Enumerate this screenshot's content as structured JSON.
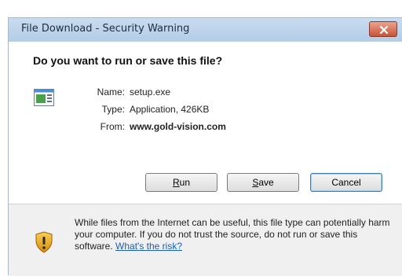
{
  "dialog": {
    "title": "File Download - Security Warning",
    "question": "Do you want to run or save this file?",
    "name_label": "Name:",
    "name_value": "setup.exe",
    "type_label": "Type:",
    "type_value": "Application, 426KB",
    "from_label": "From:",
    "from_value": "www.gold-vision.com",
    "buttons": {
      "run_mnemonic": "R",
      "run_rest": "un",
      "save_mnemonic": "S",
      "save_rest": "ave",
      "cancel": "Cancel"
    },
    "warning_text": "While files from the Internet can be useful, this file type can potentially harm your computer. If you do not trust the source, do not run or save this software.",
    "risk_link": "What's the risk?"
  },
  "icons": {
    "file": "application-file-icon",
    "warning": "warning-shield-icon",
    "close": "close-icon"
  },
  "colors": {
    "title_bar": "#c9dcf0",
    "close_button": "#c9533a",
    "shield_gold": "#e8a817",
    "link": "#1a5fb4"
  }
}
